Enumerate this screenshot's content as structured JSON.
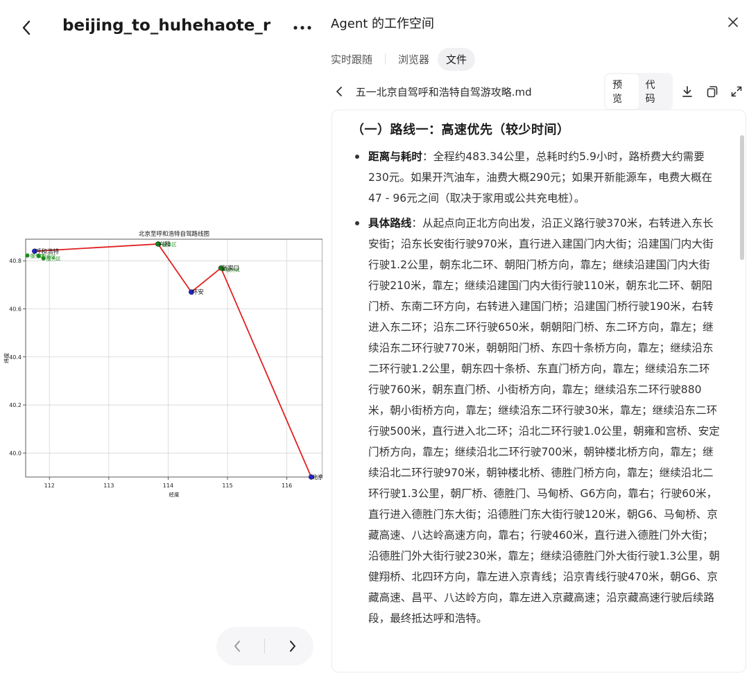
{
  "left_pane": {
    "file_title": "beijing_to_huhehaote_rou...",
    "pager": {
      "prev_icon": "chevron-left-icon",
      "next_icon": "chevron-right-icon"
    }
  },
  "right_pane": {
    "workspace_title": "Agent 的工作空间",
    "tabs": [
      {
        "label": "实时跟随",
        "active": false
      },
      {
        "label": "浏览器",
        "active": false
      },
      {
        "label": "文件",
        "active": true
      }
    ],
    "file_name": "五一北京自驾呼和浩特自驾游攻略.md",
    "view_modes": [
      {
        "label": "预览",
        "active": true
      },
      {
        "label": "代码",
        "active": false
      }
    ],
    "document": {
      "section_heading": "（一）路线一：高速优先（较少时间）",
      "items": [
        {
          "term": "距离与耗时",
          "text": "：全程约483.34公里，总耗时约5.9小时，路桥费大约需要230元。如果开汽油车，油费大概290元；如果开新能源车，电费大概在47 - 96元之间（取决于家用或公共充电桩）。"
        },
        {
          "term": "具体路线",
          "text": "：从起点向正北方向出发，沿正义路行驶370米，右转进入东长安街；沿东长安街行驶970米，直行进入建国门内大街；沿建国门内大街行驶1.2公里，朝东北二环、朝阳门桥方向，靠左；继续沿建国门内大街行驶210米，靠左；继续沿建国门内大街行驶110米，朝东北二环、朝阳门桥、东南二环方向，右转进入建国门桥；沿建国门桥行驶190米，右转进入东二环；沿东二环行驶650米，朝朝阳门桥、东二环方向，靠左；继续沿东二环行驶770米，朝朝阳门桥、东四十条桥方向，靠左；继续沿东二环行驶1.2公里，朝东四十条桥、东直门桥方向，靠左；继续沿东二环行驶760米，朝东直门桥、小街桥方向，靠左；继续沿东二环行驶880米，朝小街桥方向，靠左；继续沿东二环行驶30米，靠左；继续沿东二环行驶500米，直行进入北二环；沿北二环行驶1.0公里，朝雍和宫桥、安定门桥方向，靠左；继续沿北二环行驶700米，朝钟楼北桥方向，靠左；继续沿北二环行驶970米，朝钟楼北桥、德胜门桥方向，靠左；继续沿北二环行驶1.3公里，朝厂桥、德胜门、马甸桥、G6方向，靠右；行驶60米，直行进入德胜门东大街；沿德胜门东大街行驶120米，朝G6、马甸桥、京藏高速、八达岭高速方向，靠右；行驶460米，直行进入德胜门外大街；沿德胜门外大街行驶230米，靠左；继续沿德胜门外大街行驶1.3公里，朝健翔桥、北四环方向，靠左进入京青线；沿京青线行驶470米，朝G6、京藏高速、昌平、八达岭方向，靠左进入京藏高速；沿京藏高速行驶后续路段，最终抵达呼和浩特。"
        }
      ]
    }
  },
  "chart_data": {
    "type": "scatter",
    "title": "北京至呼和浩特自驾路线图",
    "xlabel": "经度",
    "ylabel": "纬度",
    "xlim": [
      111.6,
      116.6
    ],
    "ylim": [
      39.9,
      40.89
    ],
    "xticks": [
      "112",
      "113",
      "114",
      "115",
      "116"
    ],
    "yticks": [
      "40.0",
      "40.2",
      "40.4",
      "40.6",
      "40.8"
    ],
    "grid": true,
    "route_color": "#e02020",
    "route": [
      {
        "label": "北京",
        "x": 116.41,
        "y": 39.9,
        "color": "#2222cc"
      },
      {
        "label": "张家口",
        "x": 114.89,
        "y": 40.77,
        "color": "#1a7a1a"
      },
      {
        "label": "怀安",
        "x": 114.39,
        "y": 40.67,
        "color": "#2222cc"
      },
      {
        "label": "兴和",
        "x": 113.83,
        "y": 40.87,
        "color": "#1a7a1a"
      },
      {
        "label": "呼和浩特",
        "x": 111.75,
        "y": 40.84,
        "color": "#2222cc"
      }
    ],
    "service_areas": [
      {
        "label": "服务区",
        "x": 113.85,
        "y": 40.87
      },
      {
        "label": "服务区",
        "x": 114.92,
        "y": 40.765
      },
      {
        "label": "服务区",
        "x": 111.82,
        "y": 40.82
      },
      {
        "label": "服务区",
        "x": 111.9,
        "y": 40.81
      },
      {
        "label": "服务区",
        "x": 111.63,
        "y": 40.822
      }
    ]
  }
}
